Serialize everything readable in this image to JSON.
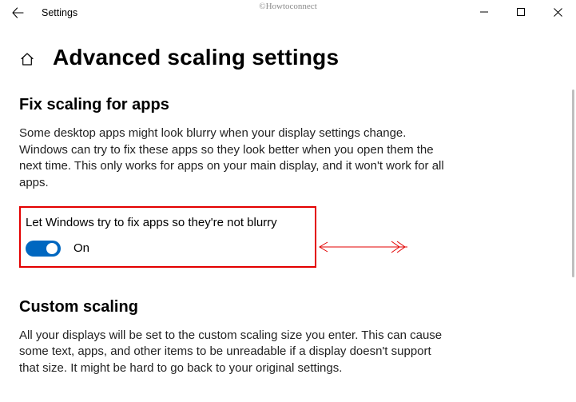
{
  "titlebar": {
    "app_name": "Settings"
  },
  "watermark": "©Howtoconnect",
  "page": {
    "title": "Advanced scaling settings"
  },
  "section1": {
    "heading": "Fix scaling for apps",
    "description": "Some desktop apps might look blurry when your display settings change. Windows can try to fix these apps so they look better when you open them the next time. This only works for apps on your main display, and it won't work for all apps.",
    "toggle_label": "Let Windows try to fix apps so they're not blurry",
    "toggle_state": "On"
  },
  "section2": {
    "heading": "Custom scaling",
    "description": "All your displays will be set to the custom scaling size you enter. This can cause some text, apps, and other items to be unreadable if a display doesn't support that size. It might be hard to go back to your original settings."
  }
}
